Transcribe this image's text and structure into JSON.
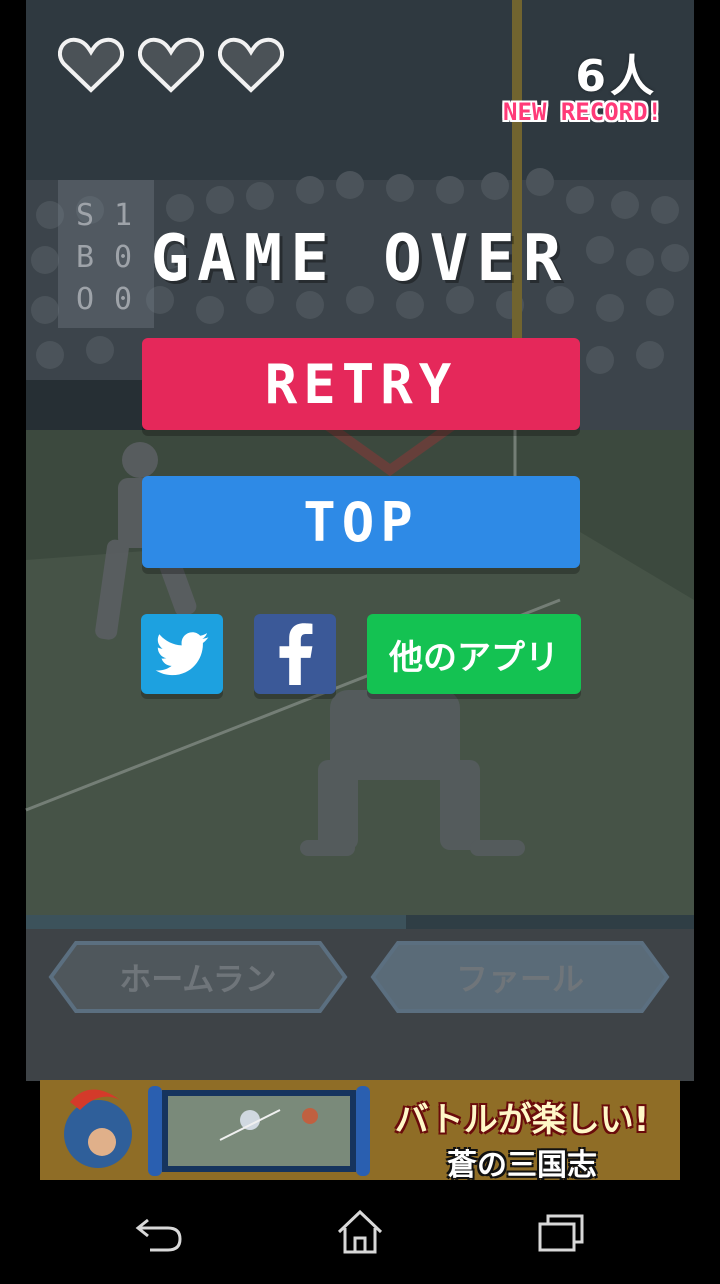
{
  "hud": {
    "lives_total": 3,
    "score_value": "6",
    "score_unit": "人",
    "record_text": "NEW RECORD!"
  },
  "scoreboard": {
    "s_label": "S",
    "s_value": "1",
    "b_label": "B",
    "b_value": "0",
    "o_label": "O",
    "o_value": "0"
  },
  "game_over_text": "GAME OVER",
  "buttons": {
    "retry": "RETRY",
    "top": "TOP",
    "twitter_icon": "twitter-bird-icon",
    "facebook_icon": "facebook-f-icon",
    "other_apps": "他のアプリ"
  },
  "judge_buttons": {
    "home_run": "ホームラン",
    "foul": "ファール"
  },
  "ad": {
    "headline": "バトルが楽しい!",
    "subtitle": "蒼の三国志"
  },
  "navbar": {
    "icons": [
      "back-icon",
      "home-icon",
      "recents-icon"
    ]
  },
  "colors": {
    "retry": "#e5285a",
    "top": "#2e8ae6",
    "twitter": "#1da1e0",
    "facebook": "#3b5998",
    "other_apps": "#14c252",
    "record": "#ff3a78"
  }
}
